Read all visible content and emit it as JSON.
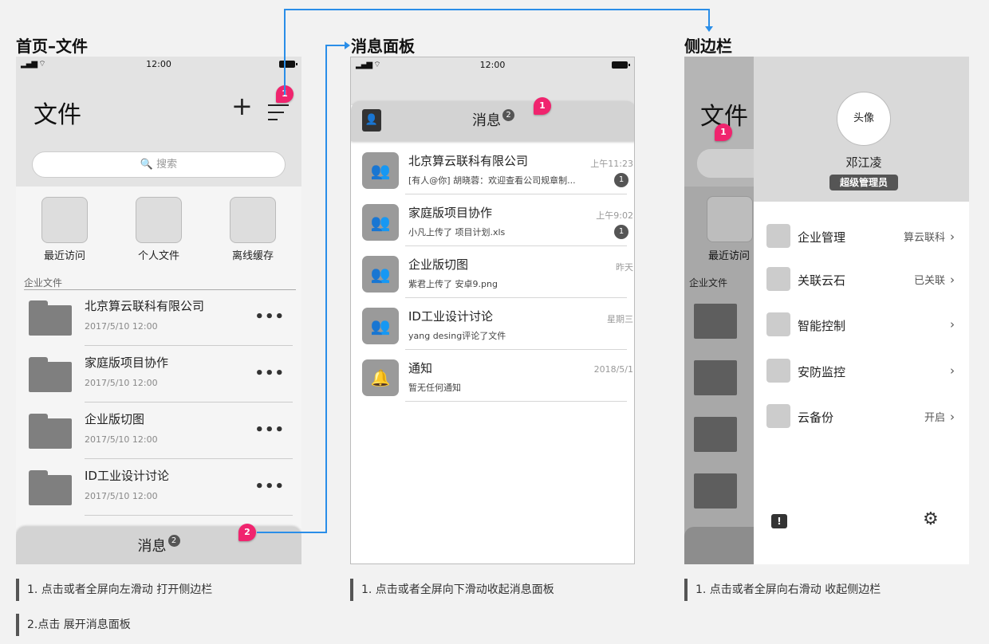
{
  "sections": {
    "home": "首页–文件",
    "messages": "消息面板",
    "sidebar": "侧边栏"
  },
  "status": {
    "time": "12:00"
  },
  "home": {
    "title": "文件",
    "plus": "+",
    "search_placeholder": "搜索",
    "quick": [
      {
        "label": "最近访问"
      },
      {
        "label": "个人文件"
      },
      {
        "label": "离线缓存"
      }
    ],
    "section_label": "企业文件",
    "folders": [
      {
        "name": "北京算云联科有限公司",
        "date": "2017/5/10 12:00"
      },
      {
        "name": "家庭版项目协作",
        "date": "2017/5/10 12:00"
      },
      {
        "name": "企业版切图",
        "date": "2017/5/10 12:00"
      },
      {
        "name": "ID工业设计讨论",
        "date": "2017/5/10 12:00"
      }
    ],
    "more": "•••",
    "bottom_label": "消息",
    "bottom_count": "2",
    "badge1": "1",
    "badge2": "2"
  },
  "messages": {
    "header_label": "消息",
    "header_count": "2",
    "badge1": "1",
    "items": [
      {
        "title": "北京算云联科有限公司",
        "sub": "[有人@你] 胡晓蓉：欢迎查看公司规章制...",
        "time": "上午11:23",
        "count": "1",
        "icon": "group-icon"
      },
      {
        "title": "家庭版项目协作",
        "sub": "小凡上传了 项目计划.xls",
        "time": "上午9:02",
        "count": "1",
        "icon": "group-icon"
      },
      {
        "title": "企业版切图",
        "sub": "紫君上传了 安卓9.png",
        "time": "昨天",
        "count": "",
        "icon": "group-icon"
      },
      {
        "title": "ID工业设计讨论",
        "sub": "yang desing评论了文件",
        "time": "星期三",
        "count": "",
        "icon": "group-icon"
      },
      {
        "title": "通知",
        "sub": "暂无任何通知",
        "time": "2018/5/1",
        "count": "",
        "icon": "bell-icon"
      }
    ]
  },
  "sidebar": {
    "bg_title": "文件",
    "bg_quick_label": "最近访问",
    "bg_section": "企业文件",
    "avatar": "头像",
    "name": "邓江凌",
    "role": "超级管理员",
    "badge1": "1",
    "items": [
      {
        "label": "企业管理",
        "value": "算云联科"
      },
      {
        "label": "关联云石",
        "value": "已关联"
      },
      {
        "label": "智能控制",
        "value": ""
      },
      {
        "label": "安防监控",
        "value": ""
      },
      {
        "label": "云备份",
        "value": "开启"
      }
    ]
  },
  "notes": {
    "home1": "1. 点击或者全屏向左滑动 打开侧边栏",
    "home2": "2.点击 展开消息面板",
    "messages1": "1. 点击或者全屏向下滑动收起消息面板",
    "sidebar1": "1. 点击或者全屏向右滑动 收起侧边栏"
  },
  "colors": {
    "accent": "#f0246e",
    "connector": "#2a8ee8"
  }
}
